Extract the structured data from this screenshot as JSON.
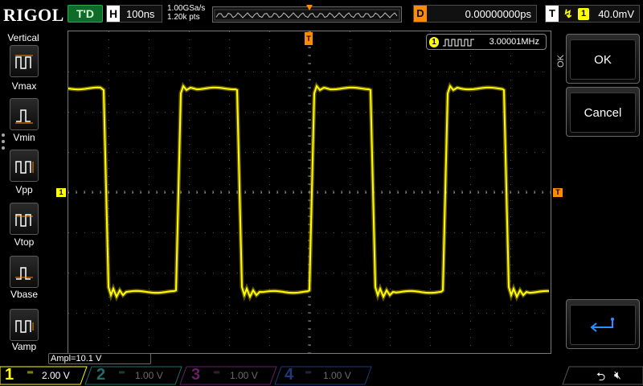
{
  "header": {
    "brand": "RIGOL",
    "run_state": "T'D",
    "horizontal": {
      "label": "H",
      "timebase": "100ns"
    },
    "sample_rate": "1.00GSa/s",
    "memory_depth": "1.20k pts",
    "delay": {
      "label": "D",
      "value": "0.00000000ps"
    },
    "trigger": {
      "label": "T",
      "edge_icon": "rising-edge-icon",
      "source": "1",
      "level": "40.0mV"
    }
  },
  "left_menu": {
    "title": "Vertical",
    "items": [
      {
        "label": "Vmax",
        "icon": "vmax-icon"
      },
      {
        "label": "Vmin",
        "icon": "vmin-icon"
      },
      {
        "label": "Vpp",
        "icon": "vpp-icon"
      },
      {
        "label": "Vtop",
        "icon": "vtop-icon"
      },
      {
        "label": "Vbase",
        "icon": "vbase-icon"
      },
      {
        "label": "Vamp",
        "icon": "vamp-icon"
      }
    ]
  },
  "display": {
    "frequency": {
      "channel": "1",
      "value": "3.00001MHz"
    },
    "ch1_marker": "1",
    "trigger_level_marker": "T",
    "trigger_pos_marker": "T",
    "measurement": "Ampl=10.1 V",
    "trace_color": "#ffff00"
  },
  "right_menu": {
    "side_tag": "OK",
    "ok_label": "OK",
    "cancel_label": "Cancel",
    "enter_icon": "enter-return-icon"
  },
  "channels": [
    {
      "number": "1",
      "scale": "2.00 V",
      "color": "#ffff00",
      "active": true
    },
    {
      "number": "2",
      "scale": "1.00 V",
      "color": "#20c0b0",
      "active": false
    },
    {
      "number": "3",
      "scale": "1.00 V",
      "color": "#c020c0",
      "active": false
    },
    {
      "number": "4",
      "scale": "1.00 V",
      "color": "#2060ff",
      "active": false
    }
  ],
  "status_icons": [
    "usb-icon",
    "speaker-mute-icon"
  ]
}
